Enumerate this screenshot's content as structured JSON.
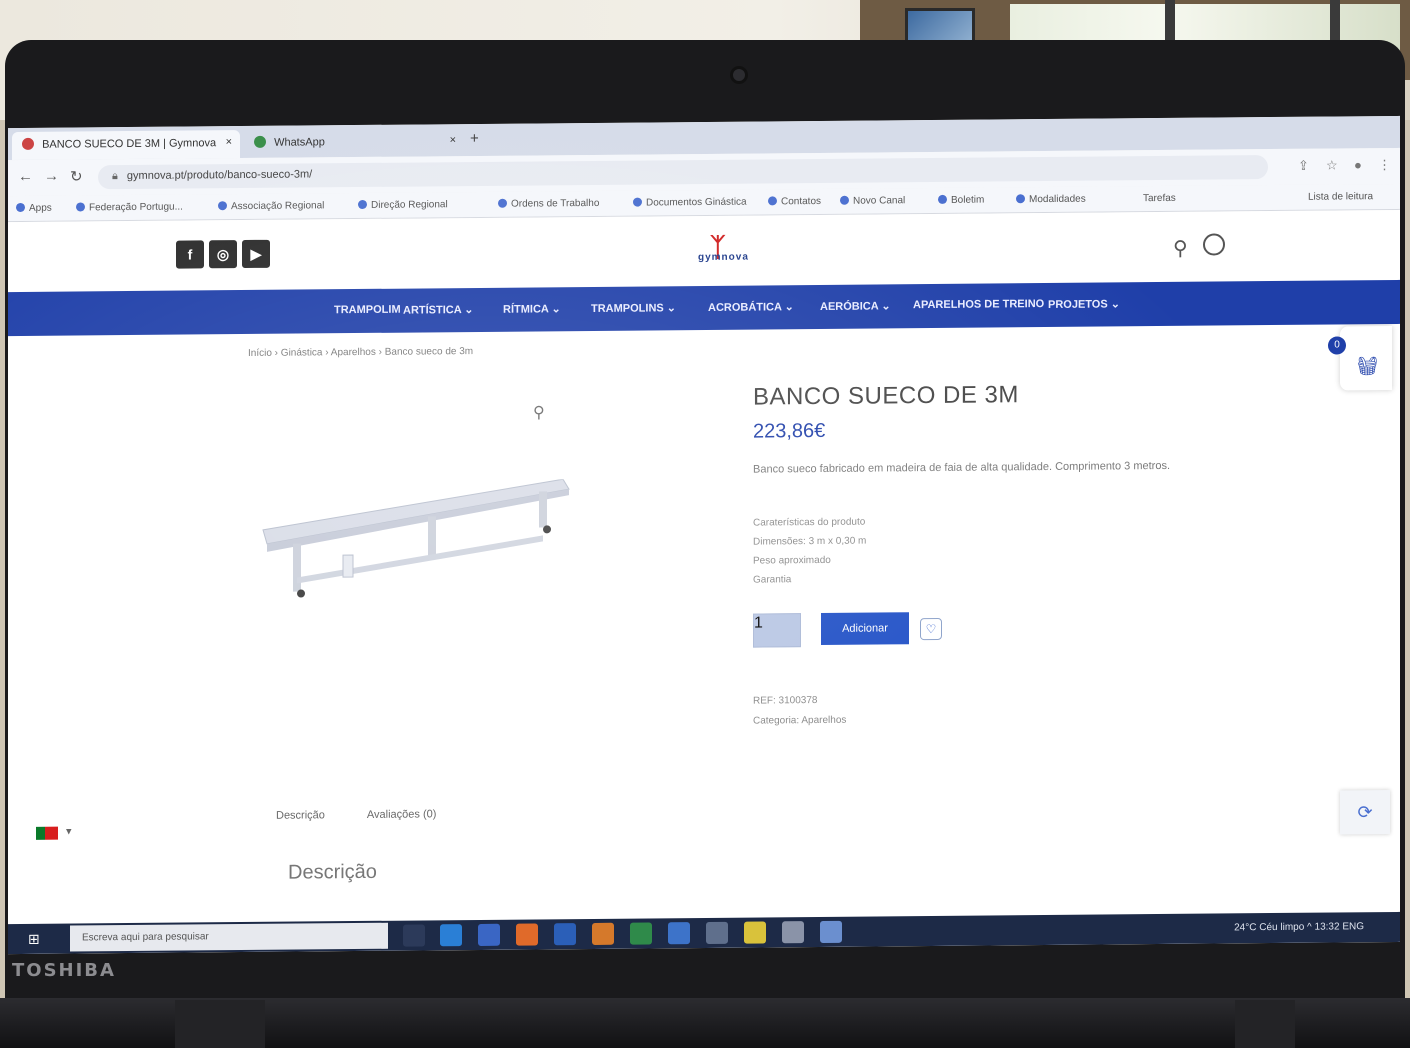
{
  "browser": {
    "tabs": [
      {
        "label": "BANCO SUECO DE 3M | Gymnova",
        "active": true
      },
      {
        "label": "WhatsApp",
        "active": false
      }
    ],
    "new_tab": "+",
    "close_glyph": "×",
    "url": "gymnova.pt/produto/banco-sueco-3m/",
    "bookmarks": [
      "Apps",
      "Federação Portugu...",
      "Associação Regional",
      "Direção Regional",
      "Ordens de Trabalho",
      "Documentos Ginástica",
      "Contatos",
      "Novo Canal",
      "Boletim",
      "Modalidades",
      "Tarefas",
      "Lista de leitura"
    ]
  },
  "site": {
    "social": {
      "facebook": "f",
      "instagram": "◎",
      "youtube": "▶"
    },
    "logo_text": "gymnova",
    "nav": [
      "TRAMPOLIM",
      "ARTÍSTICA ⌄",
      "RÍTMICA ⌄",
      "TRAMPOLINS ⌄",
      "ACROBÁTICA ⌄",
      "AERÓBICA ⌄",
      "APARELHOS DE TREINO",
      "PROJETOS ⌄"
    ],
    "breadcrumb": "Início › Ginástica › Aparelhos › Banco sueco de 3m",
    "product": {
      "title": "BANCO SUECO DE 3M",
      "price": "223,86€",
      "description": "Banco sueco fabricado em madeira de faia de alta qualidade. Comprimento 3 metros.",
      "meta": [
        "Caraterísticas do produto",
        "Dimensões: 3 m x 0,30 m",
        "Peso aproximado",
        "Garantia"
      ],
      "quantity": "1",
      "add_label": "Adicionar",
      "sku": [
        "REF: 3100378",
        "Categoria: Aparelhos"
      ]
    },
    "cart_count": "0",
    "tabs": [
      "Descrição",
      "Avaliações (0)"
    ],
    "description_heading": "Descrição"
  },
  "taskbar": {
    "search_placeholder": "Escreva aqui para pesquisar",
    "tray": "24°C Céu limpo   ^   13:32   ENG"
  },
  "device": {
    "brand": "TOSHIBA"
  },
  "colors": {
    "nav": "#1f3fa9",
    "price": "#1f3fa9",
    "button": "#1f4fc6",
    "taskbar": "#1d2a47"
  }
}
